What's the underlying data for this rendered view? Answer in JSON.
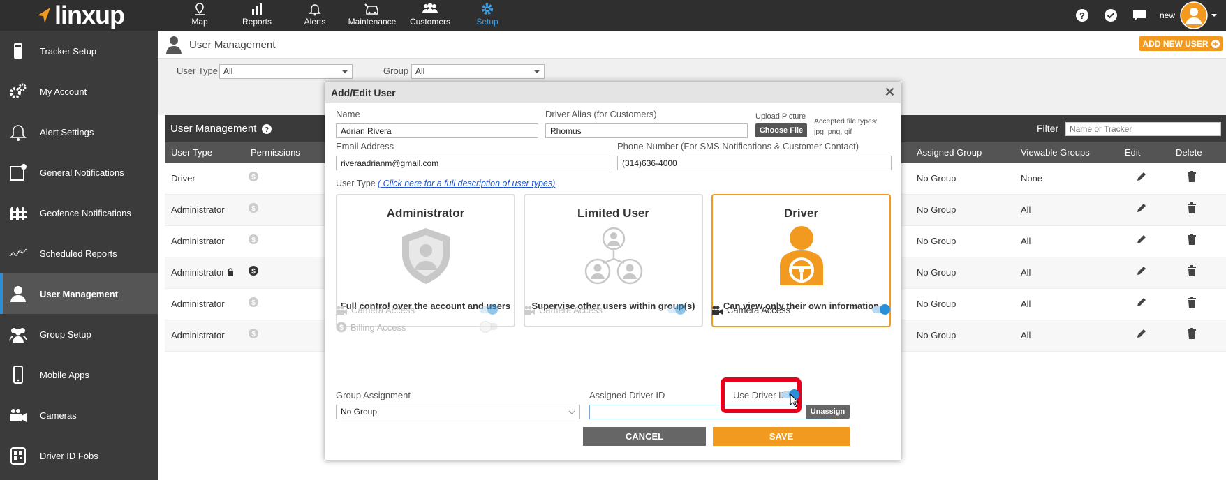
{
  "app": {
    "logo": "linxup"
  },
  "nav": [
    {
      "label": "Map",
      "icon": "map-pin-icon"
    },
    {
      "label": "Reports",
      "icon": "bar-chart-icon"
    },
    {
      "label": "Alerts",
      "icon": "bell-icon"
    },
    {
      "label": "Maintenance",
      "icon": "car-wrench-icon"
    },
    {
      "label": "Customers",
      "icon": "people-icon"
    },
    {
      "label": "Setup",
      "icon": "gear-icon",
      "active": true
    }
  ],
  "topright": {
    "user_label": "new"
  },
  "sidebar": [
    {
      "label": "Tracker Setup",
      "icon": "tracker-icon"
    },
    {
      "label": "My Account",
      "icon": "gears-icon"
    },
    {
      "label": "Alert Settings",
      "icon": "bell-icon"
    },
    {
      "label": "General Notifications",
      "icon": "notification-icon"
    },
    {
      "label": "Geofence Notifications",
      "icon": "fence-icon"
    },
    {
      "label": "Scheduled Reports",
      "icon": "trend-icon"
    },
    {
      "label": "User Management",
      "icon": "user-icon",
      "active": true
    },
    {
      "label": "Group Setup",
      "icon": "group-icon"
    },
    {
      "label": "Mobile Apps",
      "icon": "phone-icon"
    },
    {
      "label": "Cameras",
      "icon": "camera-icon"
    },
    {
      "label": "Driver ID Fobs",
      "icon": "qr-icon"
    }
  ],
  "page": {
    "title": "User Management",
    "add_button": "ADD NEW USER",
    "filter_user_type_label": "User Type",
    "filter_user_type_value": "All",
    "filter_group_label": "Group",
    "filter_group_value": "All"
  },
  "table": {
    "title": "User Management",
    "filter_label": "Filter",
    "filter_placeholder": "Name or Tracker",
    "columns": [
      "User Type",
      "Permissions",
      "Assigned Group",
      "Viewable Groups",
      "Edit",
      "Delete"
    ],
    "rows": [
      {
        "user_type": "Driver",
        "assigned_group": "No Group",
        "viewable": "None",
        "locked": false
      },
      {
        "user_type": "Administrator",
        "assigned_group": "No Group",
        "viewable": "All",
        "locked": false
      },
      {
        "user_type": "Administrator",
        "assigned_group": "No Group",
        "viewable": "All",
        "locked": false
      },
      {
        "user_type": "Administrator",
        "assigned_group": "No Group",
        "viewable": "All",
        "locked": true
      },
      {
        "user_type": "Administrator",
        "assigned_group": "No Group",
        "viewable": "All",
        "locked": false
      },
      {
        "user_type": "Administrator",
        "assigned_group": "No Group",
        "viewable": "All",
        "locked": false
      }
    ]
  },
  "modal": {
    "title": "Add/Edit User",
    "name_label": "Name",
    "name_value": "Adrian Rivera",
    "alias_label": "Driver Alias (for Customers)",
    "alias_value": "Rhomus",
    "upload_label": "Upload Picture",
    "choose_file": "Choose File",
    "accepted_types": "Accepted file types:",
    "accepted_ext": "jpg, png, gif",
    "email_label": "Email Address",
    "email_value": "riveraadrianm@gmail.com",
    "phone_label": "Phone Number (For SMS Notifications & Customer Contact)",
    "phone_value": "(314)636-4000",
    "user_type_label": "User Type",
    "user_type_link": "( Click here for a full description of user types)",
    "cards": [
      {
        "title": "Administrator",
        "desc": "Full control over the account and users",
        "icon": "shield-user-icon"
      },
      {
        "title": "Limited User",
        "desc": "Supervise other users within group(s)",
        "icon": "hierarchy-users-icon"
      },
      {
        "title": "Driver",
        "desc": "Can view only their own information",
        "icon": "driver-wheel-icon",
        "selected": true
      }
    ],
    "camera_access": "Camera Access",
    "billing_access": "Billing Access",
    "group_assignment_label": "Group Assignment",
    "group_assignment_value": "No Group",
    "driver_id_label": "Assigned Driver ID",
    "driver_id_value": "",
    "use_driver_id_label": "Use Driver ID",
    "unassign": "Unassign",
    "cancel": "CANCEL",
    "save": "SAVE"
  },
  "colors": {
    "accent": "#f29a1f",
    "highlight": "#e8001c",
    "toggle": "#2a8fd9"
  }
}
